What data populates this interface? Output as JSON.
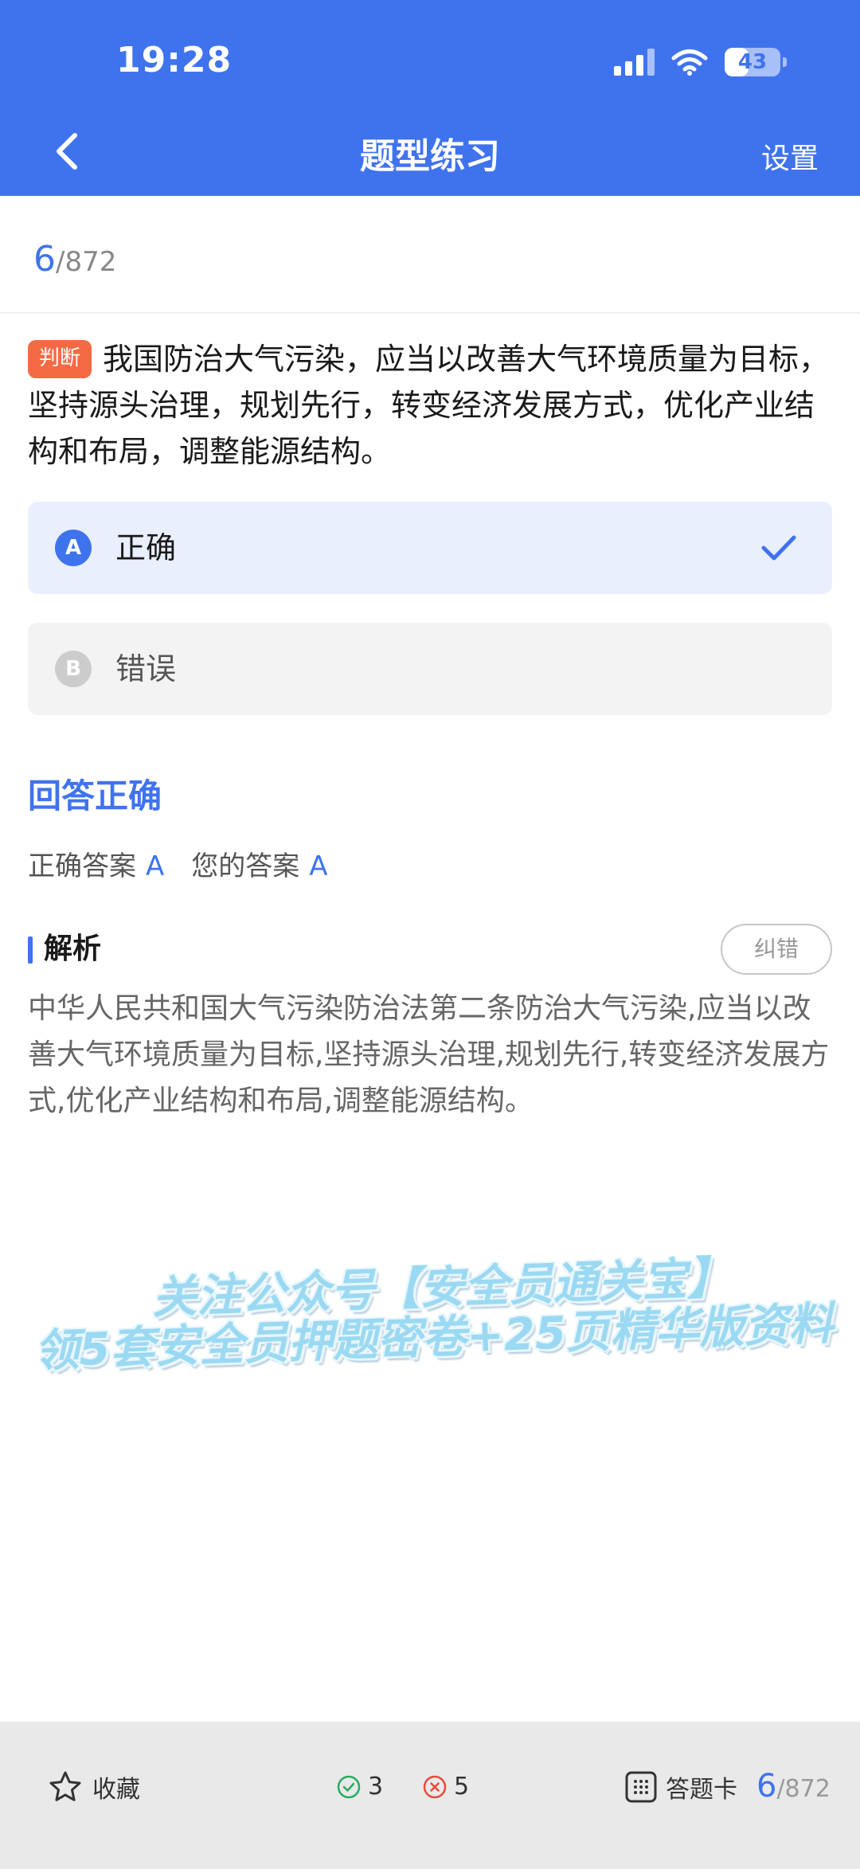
{
  "status_bar": {
    "time": "19:28",
    "battery": "43",
    "battery_level": 0.43
  },
  "nav": {
    "title": "题型练习",
    "settings_label": "设置"
  },
  "progress": {
    "current": "6",
    "total": "/872"
  },
  "question": {
    "type_tag": "判断",
    "text": "我国防治大气污染，应当以改善大气环境质量为目标，坚持源头治理，规划先行，转变经济发展方式，优化产业结构和布局，调整能源结构。"
  },
  "options": [
    {
      "letter": "A",
      "text": "正确",
      "selected": true
    },
    {
      "letter": "B",
      "text": "错误",
      "selected": false
    }
  ],
  "result": {
    "title": "回答正确",
    "correct_label": "正确答案",
    "correct_value": "A",
    "yours_label": "您的答案",
    "yours_value": "A"
  },
  "analysis": {
    "title": "解析",
    "report_label": "纠错",
    "text": "中华人民共和国大气污染防治法第二条防治大气污染,应当以改善大气环境质量为目标,坚持源头治理,规划先行,转变经济发展方式,优化产业结构和布局,调整能源结构。"
  },
  "watermark": {
    "line1": "关注公众号【安全员通关宝】",
    "line2": "领5套安全员押题密卷+25页精华版资料"
  },
  "footer": {
    "favorite_label": "收藏",
    "correct_count": "3",
    "wrong_count": "5",
    "card_label": "答题卡",
    "progress_current": "6",
    "progress_total": "/872"
  },
  "colors": {
    "primary": "#3f73ee",
    "tag": "#f46a43",
    "correct_icon": "#27ae60",
    "wrong_icon": "#e74c3c"
  }
}
